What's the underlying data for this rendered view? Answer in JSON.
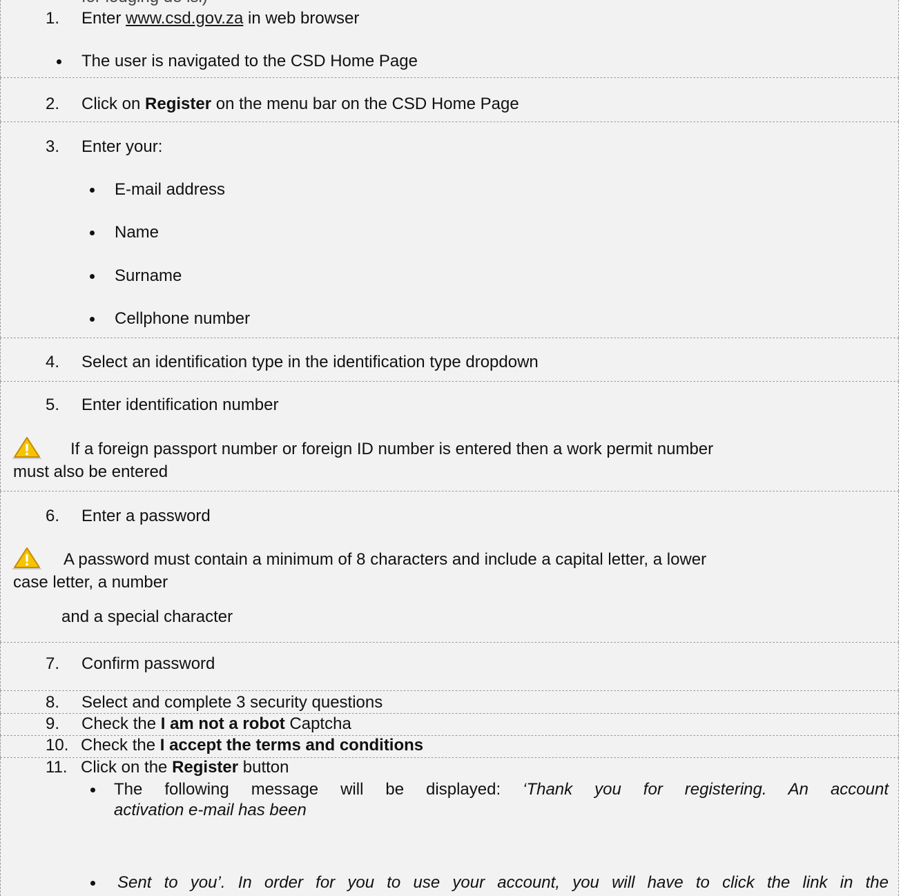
{
  "header_fragment": "for lodging de lsi)",
  "steps": {
    "s1": {
      "num": "1.",
      "pre": "Enter ",
      "link": "www.csd.gov.za",
      "post": " in web browser"
    },
    "s1_bullet": "The user is navigated to the CSD Home Page",
    "s2": {
      "num": "2.",
      "pre": "Click on ",
      "bold": "Register",
      "post": " on the menu bar on the CSD Home Page"
    },
    "s3": {
      "num": "3.",
      "text": "Enter your:"
    },
    "s3_items": [
      "E-mail address",
      "Name",
      "Surname",
      "Cellphone number"
    ],
    "s4": {
      "num": "4.",
      "text": "Select an identification type in the identification type dropdown"
    },
    "s5": {
      "num": "5.",
      "text": "Enter identification number"
    },
    "warn1": {
      "line1": "If a foreign passport number or foreign ID number is entered then a work permit number",
      "line2": "must also be entered"
    },
    "s6": {
      "num": "6.",
      "text": "Enter a password"
    },
    "warn2": {
      "line1": "A password must contain a minimum of 8 characters and include a capital letter, a lower",
      "line2": "case letter, a number",
      "line3": "and a special character"
    },
    "s7": {
      "num": "7.",
      "text": "Confirm password"
    },
    "s8": {
      "num": "8.",
      "text": "Select and complete 3 security questions"
    },
    "s9": {
      "num": "9.",
      "pre": "Check the ",
      "bold": "I am not a robot",
      "post": " Captcha"
    },
    "s10": {
      "num": "10.",
      "pre": "Check the ",
      "bold": "I accept the terms and conditions"
    },
    "s11": {
      "num": "11.",
      "pre": "Click on the ",
      "bold": "Register",
      "post": " button"
    },
    "s11_b1": {
      "pre": "The following message will be displayed: ",
      "ital1": "‘Thank you for registering. An account",
      "ital2": "activation e-mail has been"
    },
    "s11_b2": "Sent to you’. In order for you to use your account, you will have to click the link in the"
  },
  "colors": {
    "block_bg": "#f2f2f2",
    "border": "#9a9a9a",
    "warn_yellow": "#f5c400"
  }
}
